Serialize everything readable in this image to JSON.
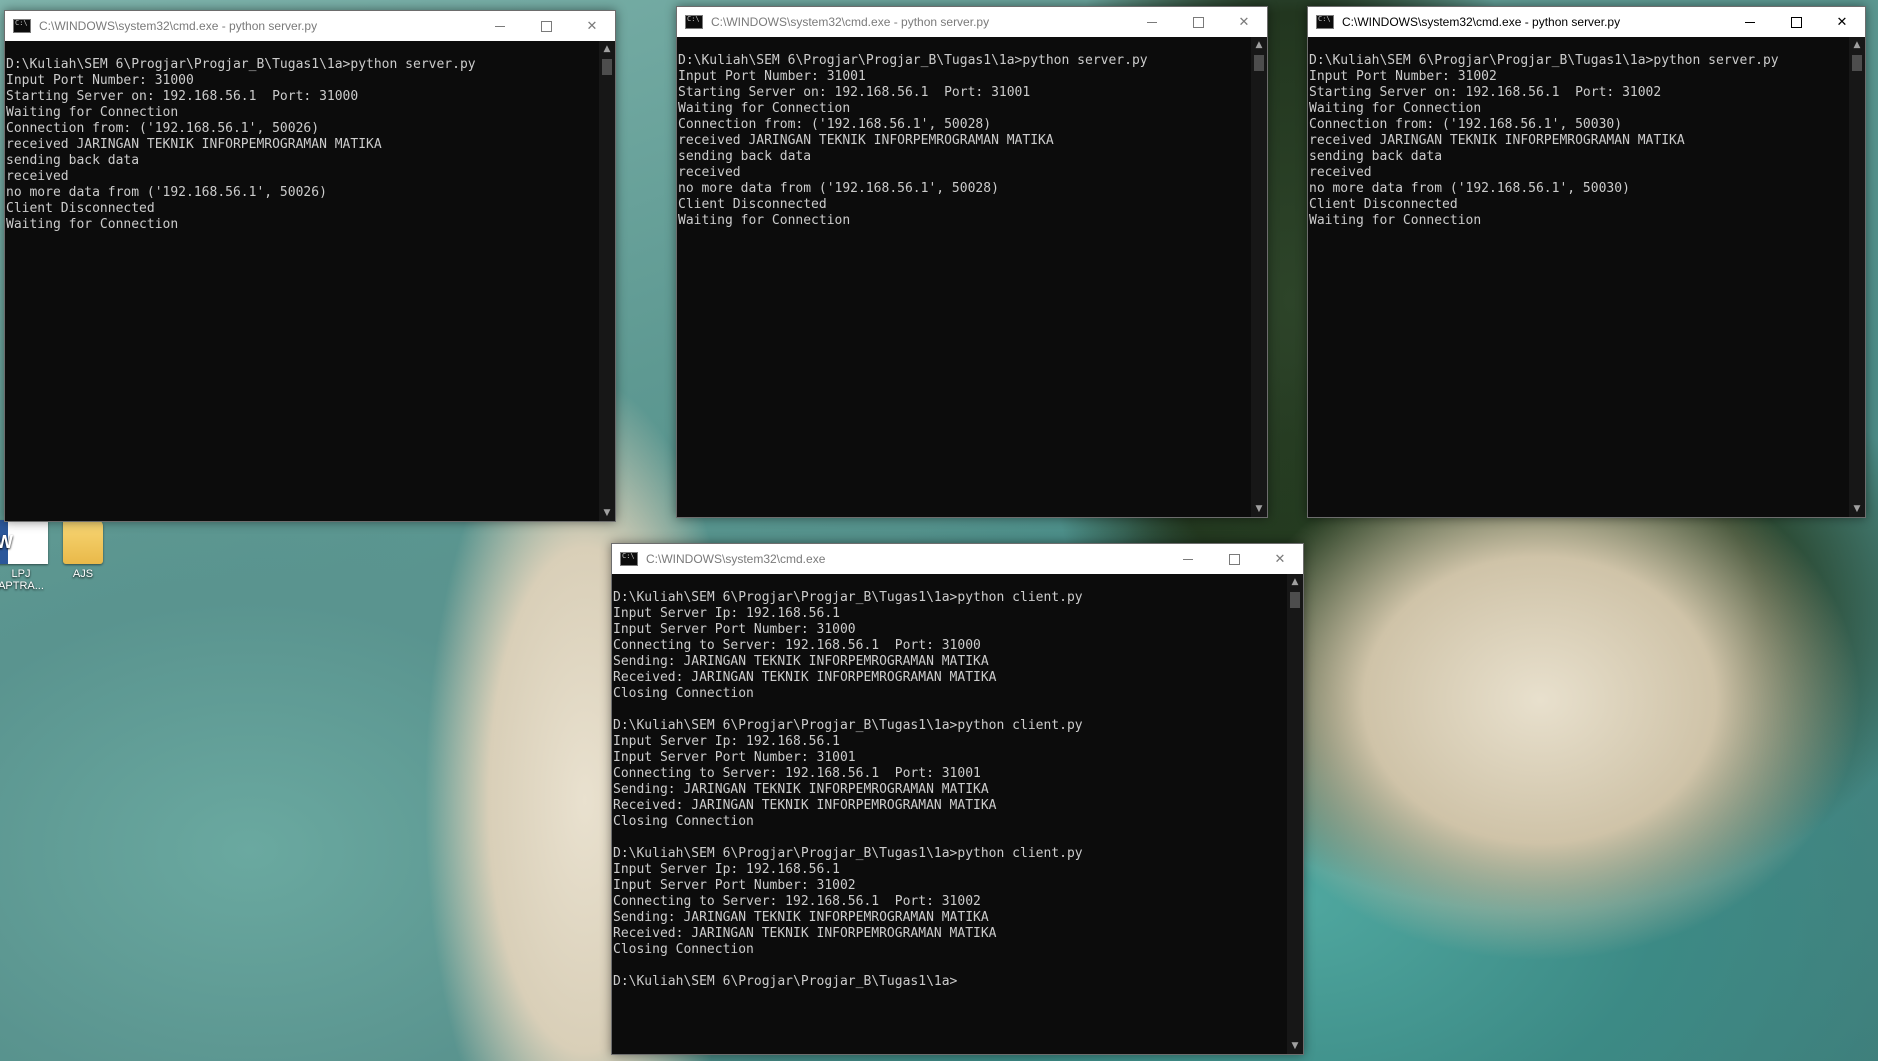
{
  "desktop": {
    "icons": [
      {
        "label": "LPJ\nAPTRA...",
        "icon": "word-document-icon"
      },
      {
        "label": "AJS",
        "icon": "folder-icon"
      }
    ]
  },
  "windows": [
    {
      "title": "C:\\WINDOWS\\system32\\cmd.exe - python  server.py",
      "active": false,
      "lines": [
        "",
        "D:\\Kuliah\\SEM 6\\Progjar\\Progjar_B\\Tugas1\\1a>python server.py",
        "Input Port Number: 31000",
        "Starting Server on: 192.168.56.1  Port: 31000",
        "Waiting for Connection",
        "Connection from: ('192.168.56.1', 50026)",
        "received JARINGAN TEKNIK INFORPEMROGRAMAN MATIKA",
        "sending back data",
        "received",
        "no more data from ('192.168.56.1', 50026)",
        "Client Disconnected",
        "Waiting for Connection"
      ]
    },
    {
      "title": "C:\\WINDOWS\\system32\\cmd.exe - python  server.py",
      "active": false,
      "lines": [
        "",
        "D:\\Kuliah\\SEM 6\\Progjar\\Progjar_B\\Tugas1\\1a>python server.py",
        "Input Port Number: 31001",
        "Starting Server on: 192.168.56.1  Port: 31001",
        "Waiting for Connection",
        "Connection from: ('192.168.56.1', 50028)",
        "received JARINGAN TEKNIK INFORPEMROGRAMAN MATIKA",
        "sending back data",
        "received",
        "no more data from ('192.168.56.1', 50028)",
        "Client Disconnected",
        "Waiting for Connection"
      ]
    },
    {
      "title": "C:\\WINDOWS\\system32\\cmd.exe - python  server.py",
      "active": true,
      "lines": [
        "",
        "D:\\Kuliah\\SEM 6\\Progjar\\Progjar_B\\Tugas1\\1a>python server.py",
        "Input Port Number: 31002",
        "Starting Server on: 192.168.56.1  Port: 31002",
        "Waiting for Connection",
        "Connection from: ('192.168.56.1', 50030)",
        "received JARINGAN TEKNIK INFORPEMROGRAMAN MATIKA",
        "sending back data",
        "received",
        "no more data from ('192.168.56.1', 50030)",
        "Client Disconnected",
        "Waiting for Connection"
      ]
    },
    {
      "title": "C:\\WINDOWS\\system32\\cmd.exe",
      "active": false,
      "lines": [
        "",
        "D:\\Kuliah\\SEM 6\\Progjar\\Progjar_B\\Tugas1\\1a>python client.py",
        "Input Server Ip: 192.168.56.1",
        "Input Server Port Number: 31000",
        "Connecting to Server: 192.168.56.1  Port: 31000",
        "Sending: JARINGAN TEKNIK INFORPEMROGRAMAN MATIKA",
        "Received: JARINGAN TEKNIK INFORPEMROGRAMAN MATIKA",
        "Closing Connection",
        "",
        "D:\\Kuliah\\SEM 6\\Progjar\\Progjar_B\\Tugas1\\1a>python client.py",
        "Input Server Ip: 192.168.56.1",
        "Input Server Port Number: 31001",
        "Connecting to Server: 192.168.56.1  Port: 31001",
        "Sending: JARINGAN TEKNIK INFORPEMROGRAMAN MATIKA",
        "Received: JARINGAN TEKNIK INFORPEMROGRAMAN MATIKA",
        "Closing Connection",
        "",
        "D:\\Kuliah\\SEM 6\\Progjar\\Progjar_B\\Tugas1\\1a>python client.py",
        "Input Server Ip: 192.168.56.1",
        "Input Server Port Number: 31002",
        "Connecting to Server: 192.168.56.1  Port: 31002",
        "Sending: JARINGAN TEKNIK INFORPEMROGRAMAN MATIKA",
        "Received: JARINGAN TEKNIK INFORPEMROGRAMAN MATIKA",
        "Closing Connection",
        "",
        "D:\\Kuliah\\SEM 6\\Progjar\\Progjar_B\\Tugas1\\1a>"
      ]
    }
  ],
  "colors": {
    "console_background": "#0c0c0c",
    "console_text": "#cccccc",
    "titlebar_background": "#ffffff"
  }
}
